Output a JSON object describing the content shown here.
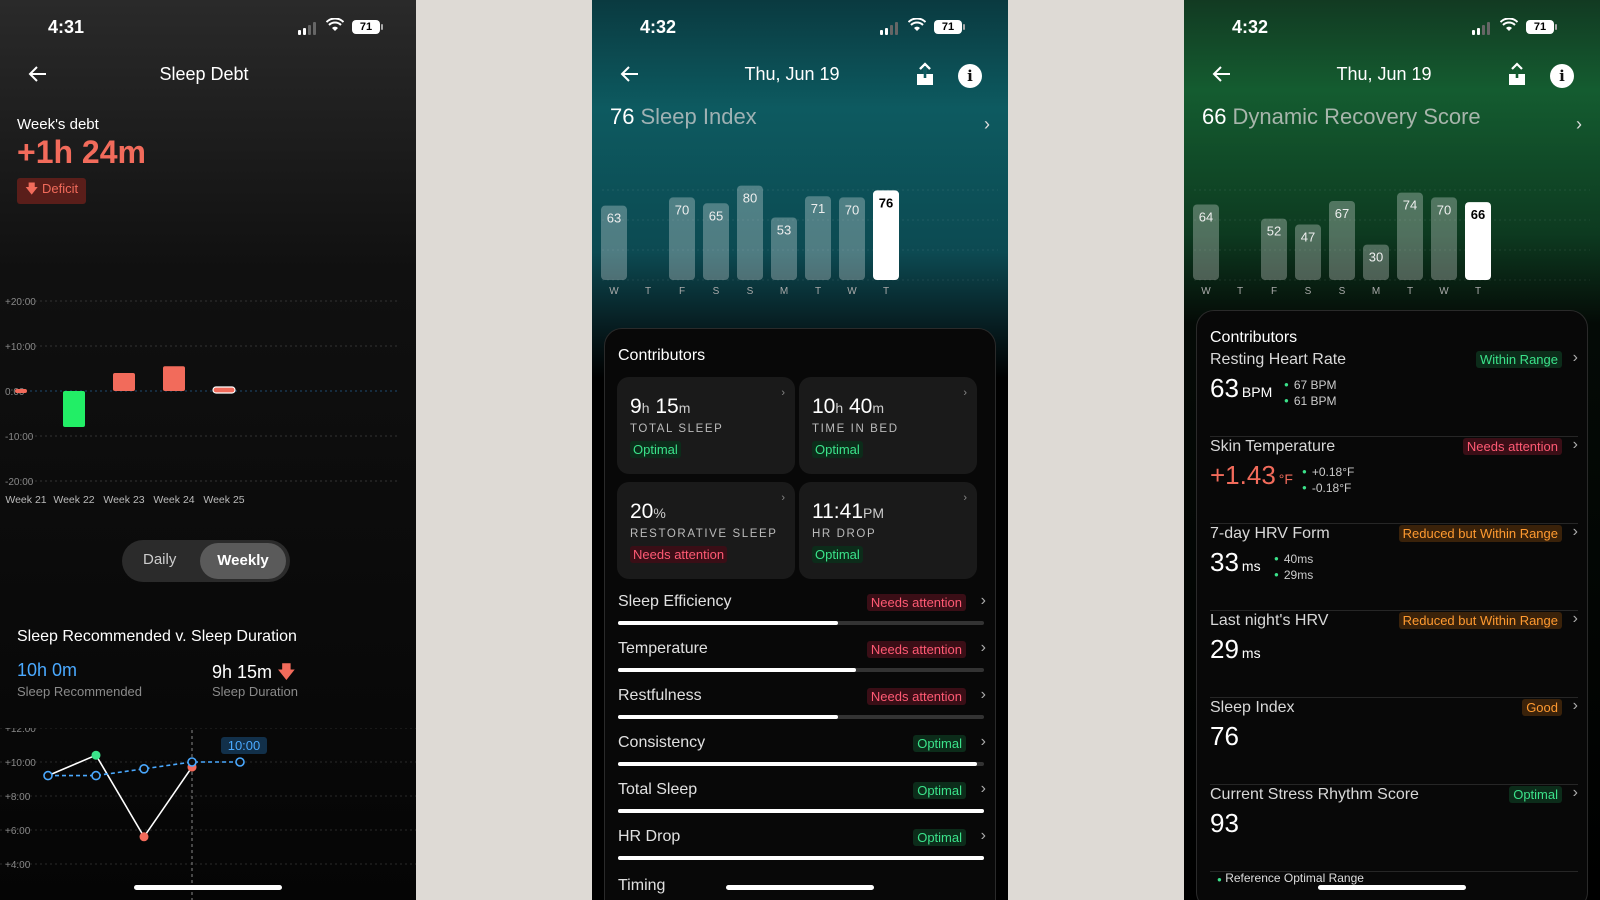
{
  "colors": {
    "accent_red": "#f26b5b",
    "accent_blue": "#4aa9ff",
    "optimal_green": "#3be28a",
    "needs_attention_red": "#ff5a74",
    "reduced_orange": "#ff9a30"
  },
  "sleep_debt": {
    "status": {
      "time": "4:31",
      "battery": "71"
    },
    "title": "Sleep Debt",
    "weeks_debt_label": "Week's debt",
    "weeks_debt_value": "+1h 24m",
    "deficit_label": "Deficit",
    "toggle": {
      "daily": "Daily",
      "weekly": "Weekly",
      "selected": "Weekly"
    },
    "rec_title": "Sleep Recommended v. Sleep Duration",
    "recommended_value": "10h 0m",
    "recommended_label": "Sleep Recommended",
    "duration_value": "9h 15m",
    "duration_label": "Sleep Duration",
    "chart_debt": {
      "type": "bar",
      "categories": [
        "Week 21",
        "Week 22",
        "Week 23",
        "Week 24",
        "Week 25"
      ],
      "values_hours": [
        0,
        -8,
        4,
        5.5,
        0.3
      ],
      "y_ticks": [
        "+20:00",
        "+10:00",
        "0:00",
        "-10:00",
        "-20:00"
      ],
      "ylim": [
        -20,
        20
      ]
    },
    "chart_trend": {
      "y_ticks": [
        "+12:00",
        "+10:00",
        "+8:00",
        "+6:00",
        "+4:00"
      ],
      "ylim": [
        4,
        12
      ],
      "recommended": [
        9.2,
        9.2,
        9.6,
        10,
        10
      ],
      "duration": [
        9.2,
        10.4,
        5.6,
        9.7
      ],
      "callout": "10:00"
    }
  },
  "sleep_index": {
    "status": {
      "time": "4:32",
      "battery": "71"
    },
    "date": "Thu, Jun 19",
    "score": "76",
    "score_label": "Sleep Index",
    "chart_data": {
      "type": "bar",
      "categories": [
        "W",
        "T",
        "F",
        "S",
        "S",
        "M",
        "T",
        "W",
        "T"
      ],
      "values": [
        63,
        null,
        70,
        65,
        80,
        53,
        71,
        70,
        76
      ],
      "highlight_index": 8
    },
    "contributors_title": "Contributors",
    "tiles": [
      {
        "value": "9",
        "unit1": "h",
        "value2": "15",
        "unit2": "m",
        "key": "TOTAL SLEEP",
        "status": "Optimal"
      },
      {
        "value": "10",
        "unit1": "h",
        "value2": "40",
        "unit2": "m",
        "key": "TIME IN BED",
        "status": "Optimal"
      },
      {
        "value": "20",
        "unit1": "%",
        "value2": "",
        "unit2": "",
        "key": "RESTORATIVE SLEEP",
        "status": "Needs attention"
      },
      {
        "value": "11:41",
        "unit1": "PM",
        "value2": "",
        "unit2": "",
        "key": "HR DROP",
        "status": "Optimal"
      }
    ],
    "rows": [
      {
        "name": "Sleep Efficiency",
        "status": "Needs attention",
        "level": 0.6
      },
      {
        "name": "Temperature",
        "status": "Needs attention",
        "level": 0.65
      },
      {
        "name": "Restfulness",
        "status": "Needs attention",
        "level": 0.6
      },
      {
        "name": "Consistency",
        "status": "Optimal",
        "level": 0.98
      },
      {
        "name": "Total Sleep",
        "status": "Optimal",
        "level": 1.0
      },
      {
        "name": "HR Drop",
        "status": "Optimal",
        "level": 1.0
      }
    ],
    "row_partial": "Timing"
  },
  "recovery": {
    "status": {
      "time": "4:32",
      "battery": "71"
    },
    "date": "Thu, Jun 19",
    "score": "66",
    "score_label": "Dynamic Recovery Score",
    "chart_data": {
      "type": "bar",
      "categories": [
        "W",
        "T",
        "F",
        "S",
        "S",
        "M",
        "T",
        "W",
        "T"
      ],
      "values": [
        64,
        null,
        52,
        47,
        67,
        30,
        74,
        70,
        66
      ],
      "highlight_index": 8
    },
    "contributors_title": "Contributors",
    "rows": [
      {
        "name": "Resting Heart Rate",
        "status": "Within Range",
        "value": "63",
        "unit": "BPM",
        "hi": "67 BPM",
        "lo": "61 BPM"
      },
      {
        "name": "Skin Temperature",
        "status": "Needs attention",
        "value": "+1.43",
        "unit": "°F",
        "hi": "+0.18°F",
        "lo": "-0.18°F"
      },
      {
        "name": "7-day HRV Form",
        "status": "Reduced but Within Range",
        "value": "33",
        "unit": "ms",
        "hi": "40ms",
        "lo": "29ms"
      },
      {
        "name": "Last night's HRV",
        "status": "Reduced but Within Range",
        "value": "29",
        "unit": "ms",
        "hi": "",
        "lo": ""
      },
      {
        "name": "Sleep Index",
        "status": "Good",
        "value": "76",
        "unit": "",
        "hi": "",
        "lo": ""
      },
      {
        "name": "Current Stress Rhythm Score",
        "status": "Optimal",
        "value": "93",
        "unit": "",
        "hi": "",
        "lo": ""
      }
    ],
    "footer_partial": "Reference Optimal Range"
  }
}
